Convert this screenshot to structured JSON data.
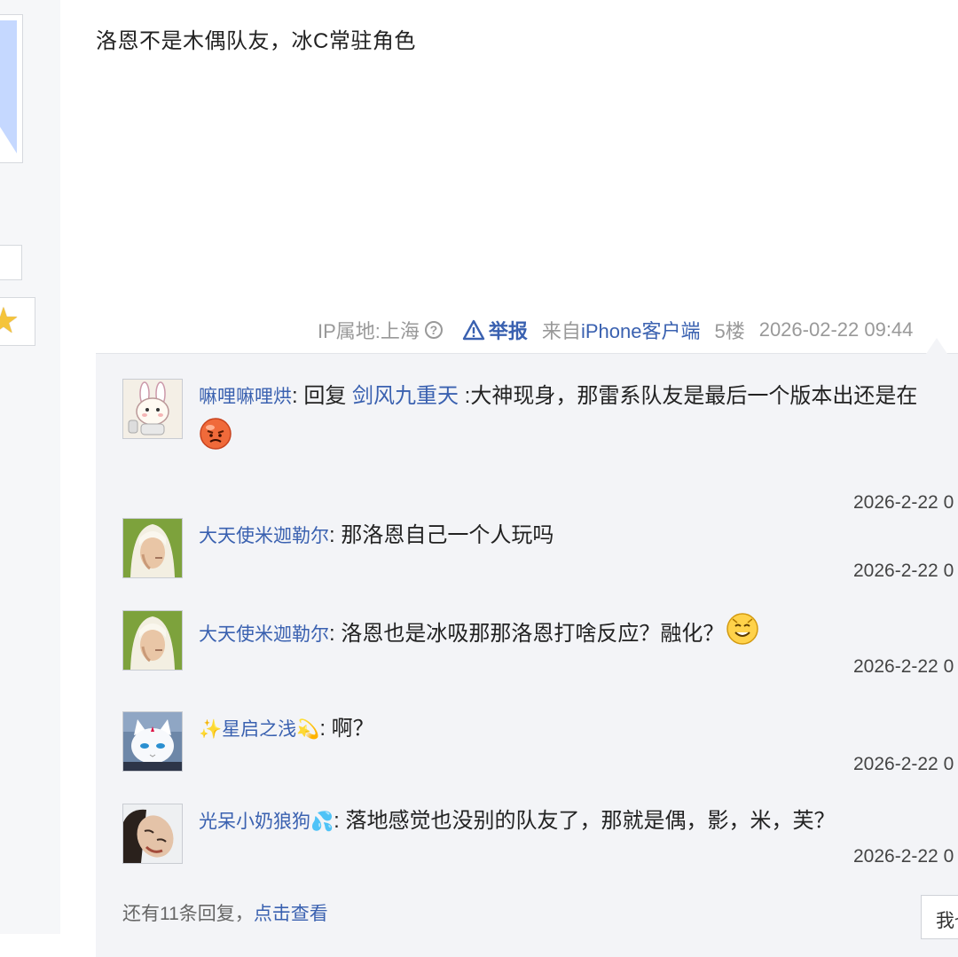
{
  "post": {
    "content": "洛恩不是木偶队友，冰C常驻角色",
    "ip_label": "IP属地:上海",
    "help_icon_glyph": "?",
    "report_label": "举报",
    "from_prefix": "来自",
    "device": "iPhone客户端",
    "floor": "5楼",
    "timestamp": "2026-02-22 09:44"
  },
  "replies": [
    {
      "name": "嘛哩嘛哩烘",
      "separator": ": ",
      "reply_prefix": "回复 ",
      "mention": "剑风九重天",
      "text": " :大神现身，那雷系队友是最后一个版本出还是在",
      "emoji": "angry-face",
      "time": "2026-2-22 0",
      "avatar": "bunny-avatar"
    },
    {
      "name": "大天使米迦勒尔",
      "separator": ": ",
      "text": "那洛恩自己一个人玩吗",
      "time": "2026-2-22 0",
      "avatar": "angel-avatar"
    },
    {
      "name": "大天使米迦勒尔",
      "separator": ": ",
      "text": "洛恩也是冰吸那那洛恩打啥反应？融化？",
      "emoji": "smile-face",
      "time": "2026-2-22 0",
      "avatar": "angel-avatar"
    },
    {
      "name_prefix_glyph": "✨",
      "name": "星启之浅",
      "name_suffix_glyph": "💫",
      "separator": ": ",
      "text": "啊？",
      "time": "2026-2-22 0",
      "avatar": "white-cat-avatar"
    },
    {
      "name": "光呆小奶狼狗",
      "name_suffix_glyph": "💦",
      "separator": ": ",
      "text": "落地感觉也没别的队友了，那就是偶，影，米，芙？",
      "time": "2026-2-22 0",
      "avatar": "person-avatar"
    }
  ],
  "more": {
    "prefix": "还有11条回复，",
    "link": "点击查看"
  },
  "reply_button_label": "我也说一句",
  "left": {
    "star_glyph": "★"
  },
  "colors": {
    "link": "#3a61b0",
    "reply_bg": "#f3f4f7",
    "meta": "#999999"
  }
}
